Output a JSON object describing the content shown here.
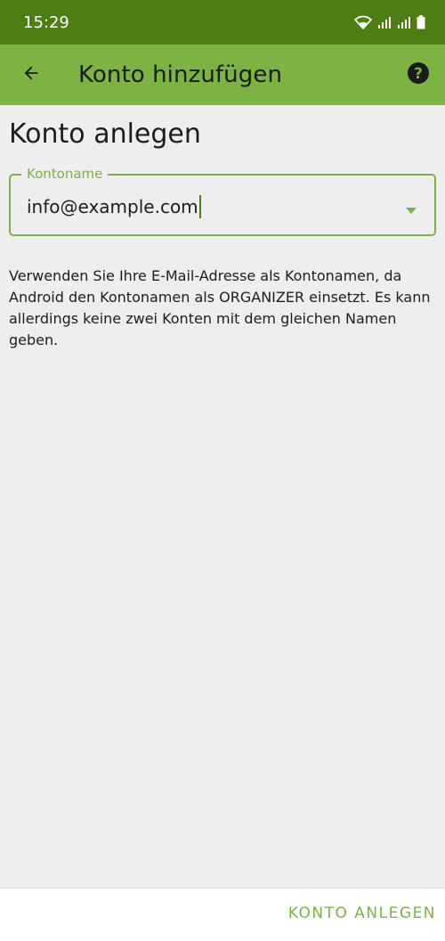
{
  "status_bar": {
    "time": "15:29",
    "icons": [
      "wifi-icon",
      "signal-icon",
      "signal-icon",
      "battery-icon"
    ]
  },
  "app_bar": {
    "title": "Konto hinzufügen",
    "back_icon": "arrow-back-icon",
    "help_icon": "help-icon"
  },
  "page": {
    "heading": "Konto anlegen",
    "account_field": {
      "label": "Kontoname",
      "value": "info@example.com"
    },
    "info_text": "Verwenden Sie Ihre E-Mail-Adresse als Kontonamen, da Android den Kontonamen als ORGANIZER einsetzt. Es kann allerdings keine zwei Konten mit dem gleichen Namen geben."
  },
  "footer": {
    "create_button_label": "KONTO ANLEGEN"
  },
  "colors": {
    "status_bar": "#4e7d14",
    "app_bar": "#7cb342",
    "accent": "#7cb342",
    "background": "#eeeeee"
  }
}
